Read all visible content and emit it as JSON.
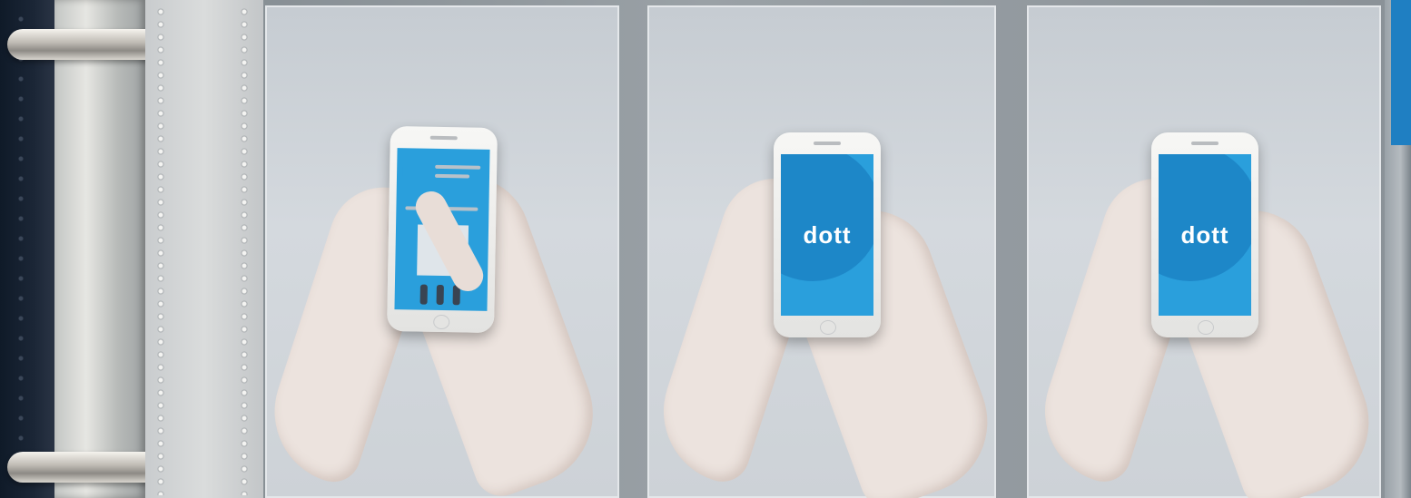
{
  "scene": {
    "description_label": "",
    "panels": [
      {
        "screen": "feed"
      },
      {
        "screen": "splash",
        "logo_text": "dott"
      },
      {
        "screen": "splash",
        "logo_text": "dott"
      }
    ]
  },
  "colors": {
    "brand_blue": "#2a9fdc",
    "brand_blue_dark": "#1b83c4",
    "binder_navy": "#1b2636"
  }
}
